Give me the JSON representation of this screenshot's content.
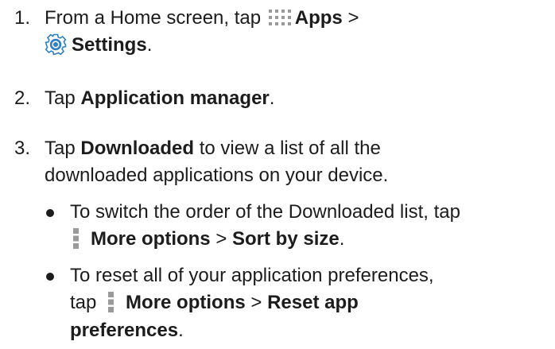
{
  "steps": [
    {
      "number": "1.",
      "line1_prefix": "From a Home screen, tap",
      "apps_label": "Apps",
      "sep": ">",
      "settings_label": "Settings",
      "end": "."
    },
    {
      "number": "2.",
      "prefix": "Tap",
      "bold": "Application manager",
      "end": "."
    },
    {
      "number": "3.",
      "prefix": "Tap",
      "bold": "Downloaded",
      "rest_line1": "to view a list of all the",
      "rest_line2": "downloaded applications on your device."
    }
  ],
  "bullets": [
    {
      "line1": "To switch the order of the Downloaded list, tap",
      "more_label": "More options",
      "sep": ">",
      "action": "Sort by size",
      "end": "."
    },
    {
      "line1": "To reset all of your application preferences,",
      "prefix": "tap",
      "more_label": "More options",
      "sep": ">",
      "action_line1": "Reset app",
      "action_line2": "preferences",
      "end": "."
    }
  ],
  "icons": {
    "apps": "apps-grid-icon",
    "settings": "settings-gear-icon",
    "more": "more-options-icon"
  },
  "colors": {
    "text": "#1c1c1c",
    "icon_gray": "#9a9a9a",
    "gear_blue": "#2f7fc4"
  }
}
